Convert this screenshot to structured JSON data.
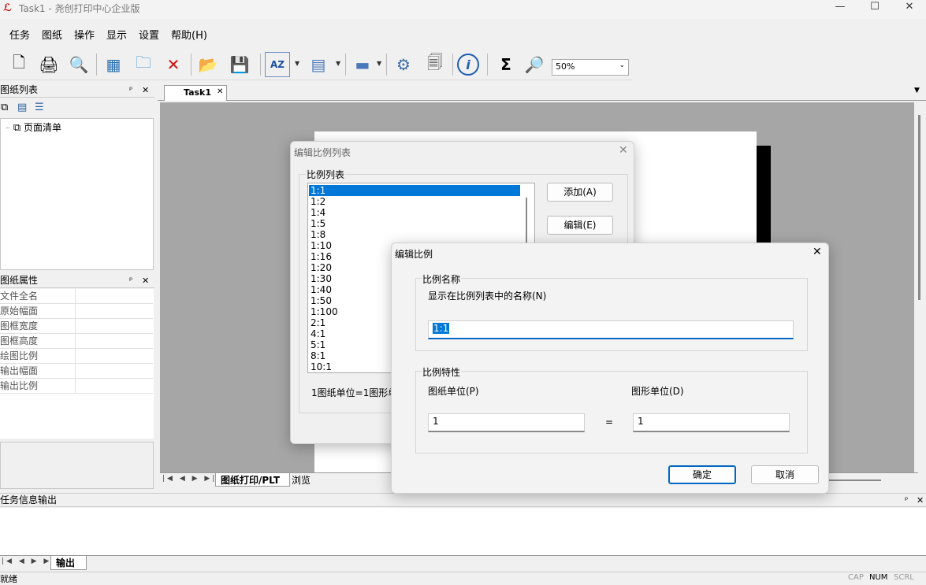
{
  "window": {
    "title": "Task1 - 尧创打印中心企业版",
    "minimize": "—",
    "maximize": "☐",
    "close": "✕"
  },
  "menu": [
    {
      "label": "任务"
    },
    {
      "label": "图纸"
    },
    {
      "label": "操作"
    },
    {
      "label": "显示"
    },
    {
      "label": "设置"
    },
    {
      "label": "帮助(H)"
    }
  ],
  "toolbar": {
    "zoom": "50%",
    "sigma": "Σ"
  },
  "left_panel": {
    "title": "图纸列表",
    "tree_item": "页面清单",
    "props_title": "图纸属性",
    "props": [
      "文件全名",
      "原始幅面",
      "图框宽度",
      "图框高度",
      "绘图比例",
      "输出幅面",
      "输出比例"
    ]
  },
  "doc_tab": "Task1",
  "bottom_tabs": {
    "print": "图纸打印/PLT",
    "browse": "浏览"
  },
  "output_panel": {
    "title": "任务信息输出",
    "tab": "输出"
  },
  "status": {
    "text": "就绪",
    "cap": "CAP",
    "num": "NUM",
    "scrl": "SCRL"
  },
  "scale_list_dialog": {
    "title": "编辑比例列表",
    "group": "比例列表",
    "items": [
      "1:1",
      "1:2",
      "1:4",
      "1:5",
      "1:8",
      "1:10",
      "1:16",
      "1:20",
      "1:30",
      "1:40",
      "1:50",
      "1:100",
      "2:1",
      "4:1",
      "5:1",
      "8:1",
      "10:1"
    ],
    "selected": "1:1",
    "add_button": "添加(A)",
    "edit_button": "编辑(E)",
    "footer": "1图纸单位=1图形单"
  },
  "edit_scale_dialog": {
    "title": "编辑比例",
    "name_group": "比例名称",
    "name_caption": "显示在比例列表中的名称(N)",
    "name_value": "1:1",
    "props_group": "比例特性",
    "paper_unit_label": "图纸单位(P)",
    "drawing_unit_label": "图形单位(D)",
    "paper_unit_value": "1",
    "drawing_unit_value": "1",
    "equals": "=",
    "ok": "确定",
    "cancel": "取消"
  }
}
